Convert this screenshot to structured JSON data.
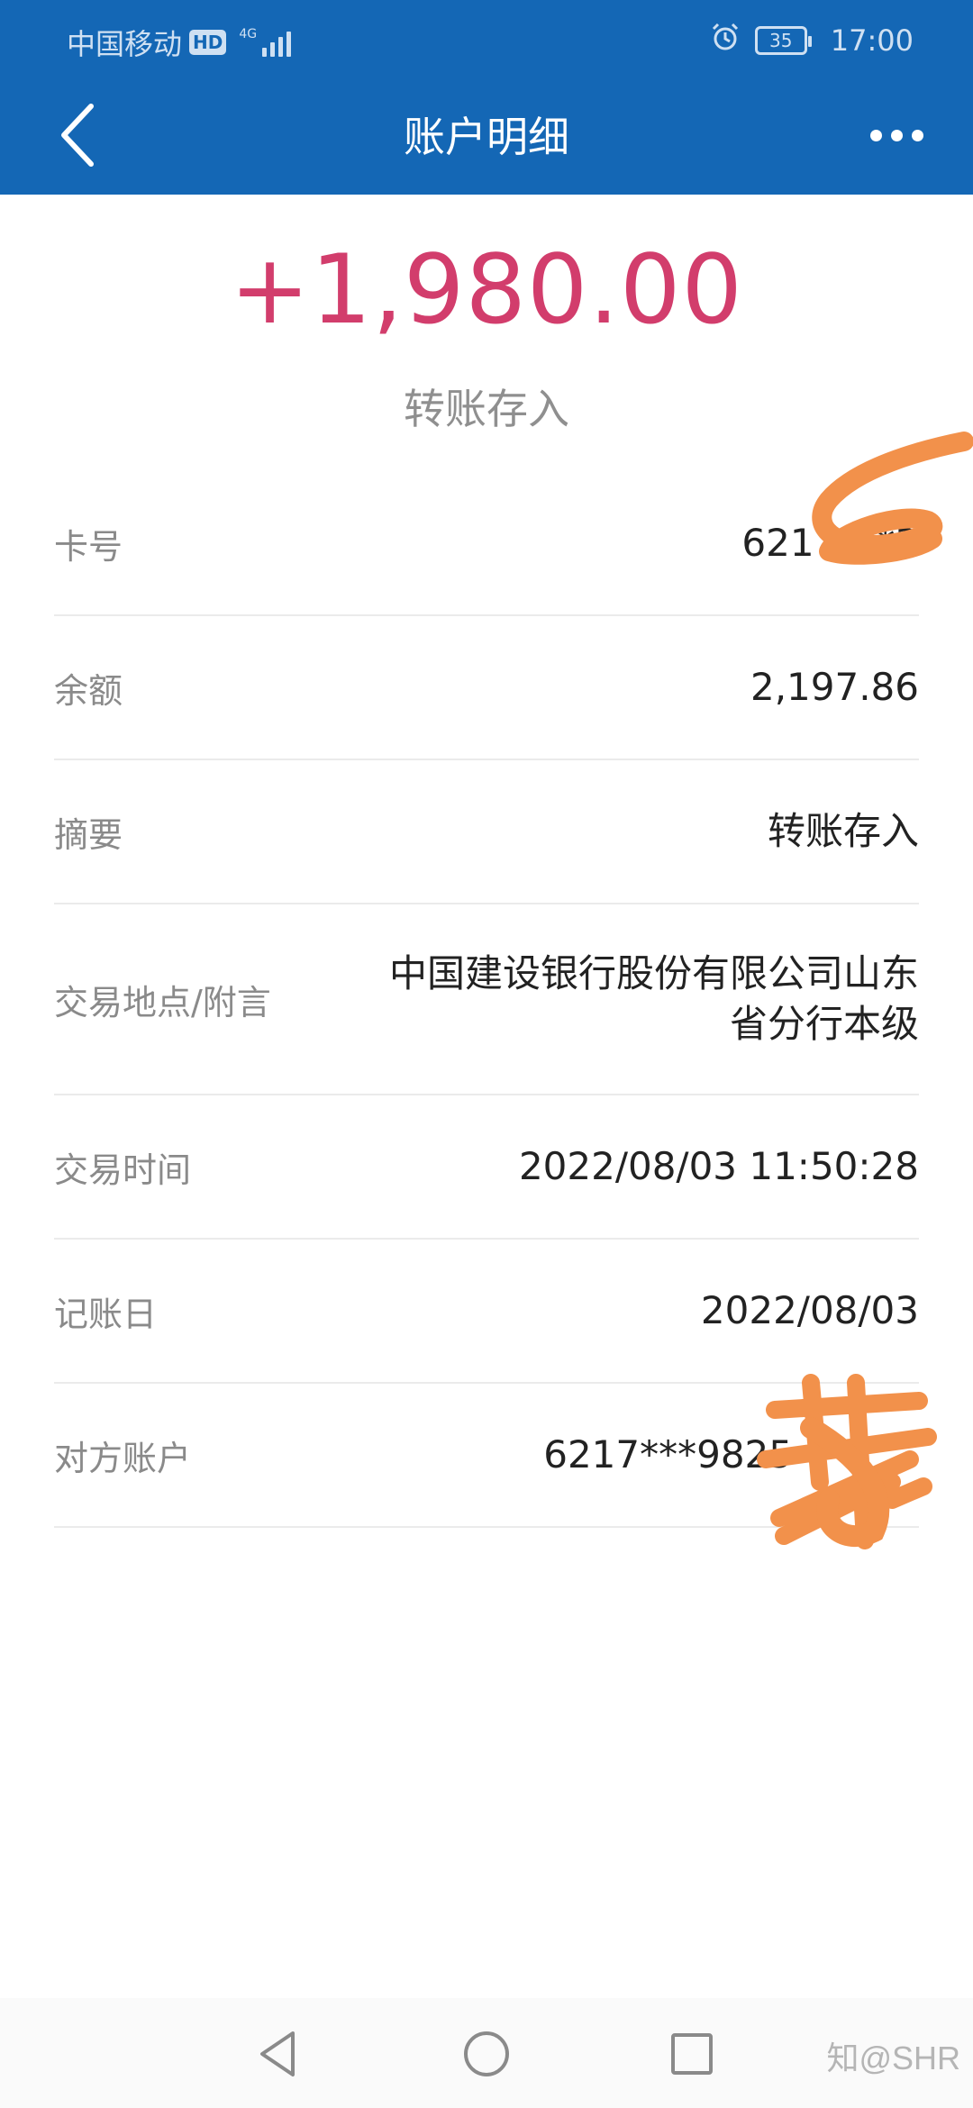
{
  "status_bar": {
    "carrier": "中国移动",
    "hd_badge": "HD",
    "network": "4G",
    "battery": "35",
    "time": "17:00"
  },
  "header": {
    "title": "账户明细"
  },
  "summary": {
    "amount": "+1,980.00",
    "type": "转账存入"
  },
  "details": [
    {
      "label": "卡号",
      "value": "6217***3"
    },
    {
      "label": "余额",
      "value": "2,197.86"
    },
    {
      "label": "摘要",
      "value": "转账存入"
    },
    {
      "label": "交易地点/附言",
      "value": "中国建设银行股份有限公司山东省分行本级"
    },
    {
      "label": "交易时间",
      "value": "2022/08/03 11:50:28"
    },
    {
      "label": "记账日",
      "value": "2022/08/03"
    },
    {
      "label": "对方账户",
      "value": "6217***9825"
    }
  ],
  "watermark": "知@SHR",
  "colors": {
    "header_bg": "#1467b5",
    "amount": "#d23d6c",
    "scribble": "#f2914b"
  },
  "icons": {
    "back": "chevron-left-icon",
    "more": "more-dots-icon",
    "alarm": "alarm-icon",
    "nav_back": "triangle-back-icon",
    "nav_home": "circle-home-icon",
    "nav_recents": "square-recents-icon"
  }
}
